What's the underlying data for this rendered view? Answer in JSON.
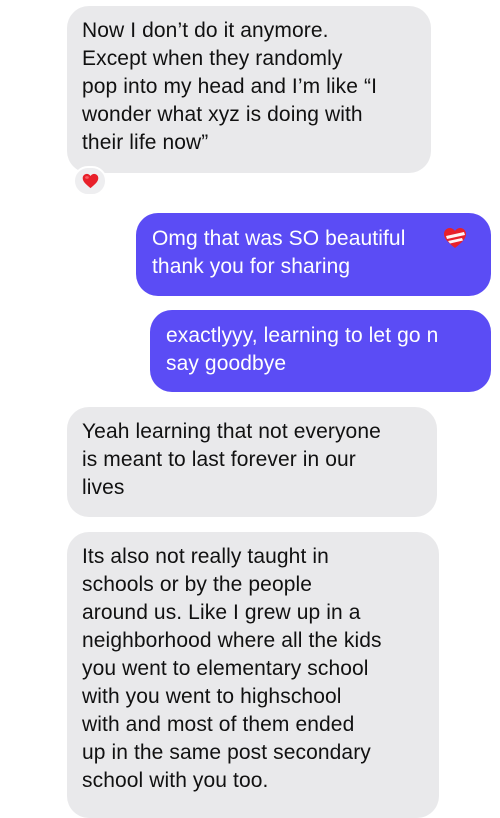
{
  "conversation": {
    "messages": [
      {
        "sender": "other",
        "text": "Now I don’t do it anymore.\nExcept when they randomly\npop into my head and I’m like “I\nwonder what xyz is doing with\ntheir life now”",
        "reaction": "red-heart-icon"
      },
      {
        "sender": "me",
        "text": "Omg that was SO beautiful\nthank you for sharing",
        "trailing_emoji": "mending-heart-icon"
      },
      {
        "sender": "me",
        "text": "exactlyyy, learning to let go n\nsay goodbye"
      },
      {
        "sender": "other",
        "text": "Yeah learning that not everyone\nis meant to last forever in our\nlives"
      },
      {
        "sender": "other",
        "text": "Its also not really taught in\nschools or by the people\naround us. Like I grew up in a\nneighborhood where all the kids\nyou went to elementary school\nwith you went to highschool\nwith and most of them ended\nup in the same post secondary\nschool with you too."
      }
    ]
  },
  "colors": {
    "incoming_bubble": "#e9e9eb",
    "outgoing_bubble": "#5b4cf5",
    "heart_red": "#e8202a"
  }
}
